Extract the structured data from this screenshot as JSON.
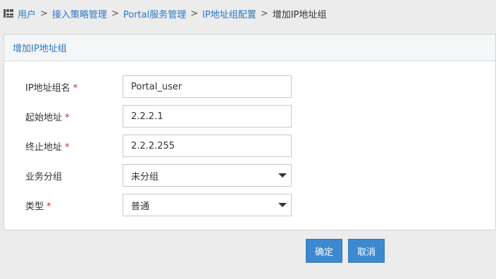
{
  "breadcrumb": {
    "items": [
      "用户",
      "接入策略管理",
      "Portal服务管理",
      "IP地址组配置"
    ],
    "current": "增加IP地址组",
    "separator": ">"
  },
  "panel": {
    "title": "增加IP地址组"
  },
  "form": {
    "group_name": {
      "label": "IP地址组名",
      "required": "*",
      "value": "Portal_user"
    },
    "start_address": {
      "label": "起始地址",
      "required": "*",
      "value": "2.2.2.1"
    },
    "end_address": {
      "label": "终止地址",
      "required": "*",
      "value": "2.2.2.255"
    },
    "service_group": {
      "label": "业务分组",
      "value": "未分组"
    },
    "type": {
      "label": "类型",
      "required": "*",
      "value": "普通"
    }
  },
  "buttons": {
    "ok": "确定",
    "cancel": "取消"
  },
  "colors": {
    "link": "#2b78c2",
    "button": "#3d89cf",
    "required": "#e02020"
  }
}
